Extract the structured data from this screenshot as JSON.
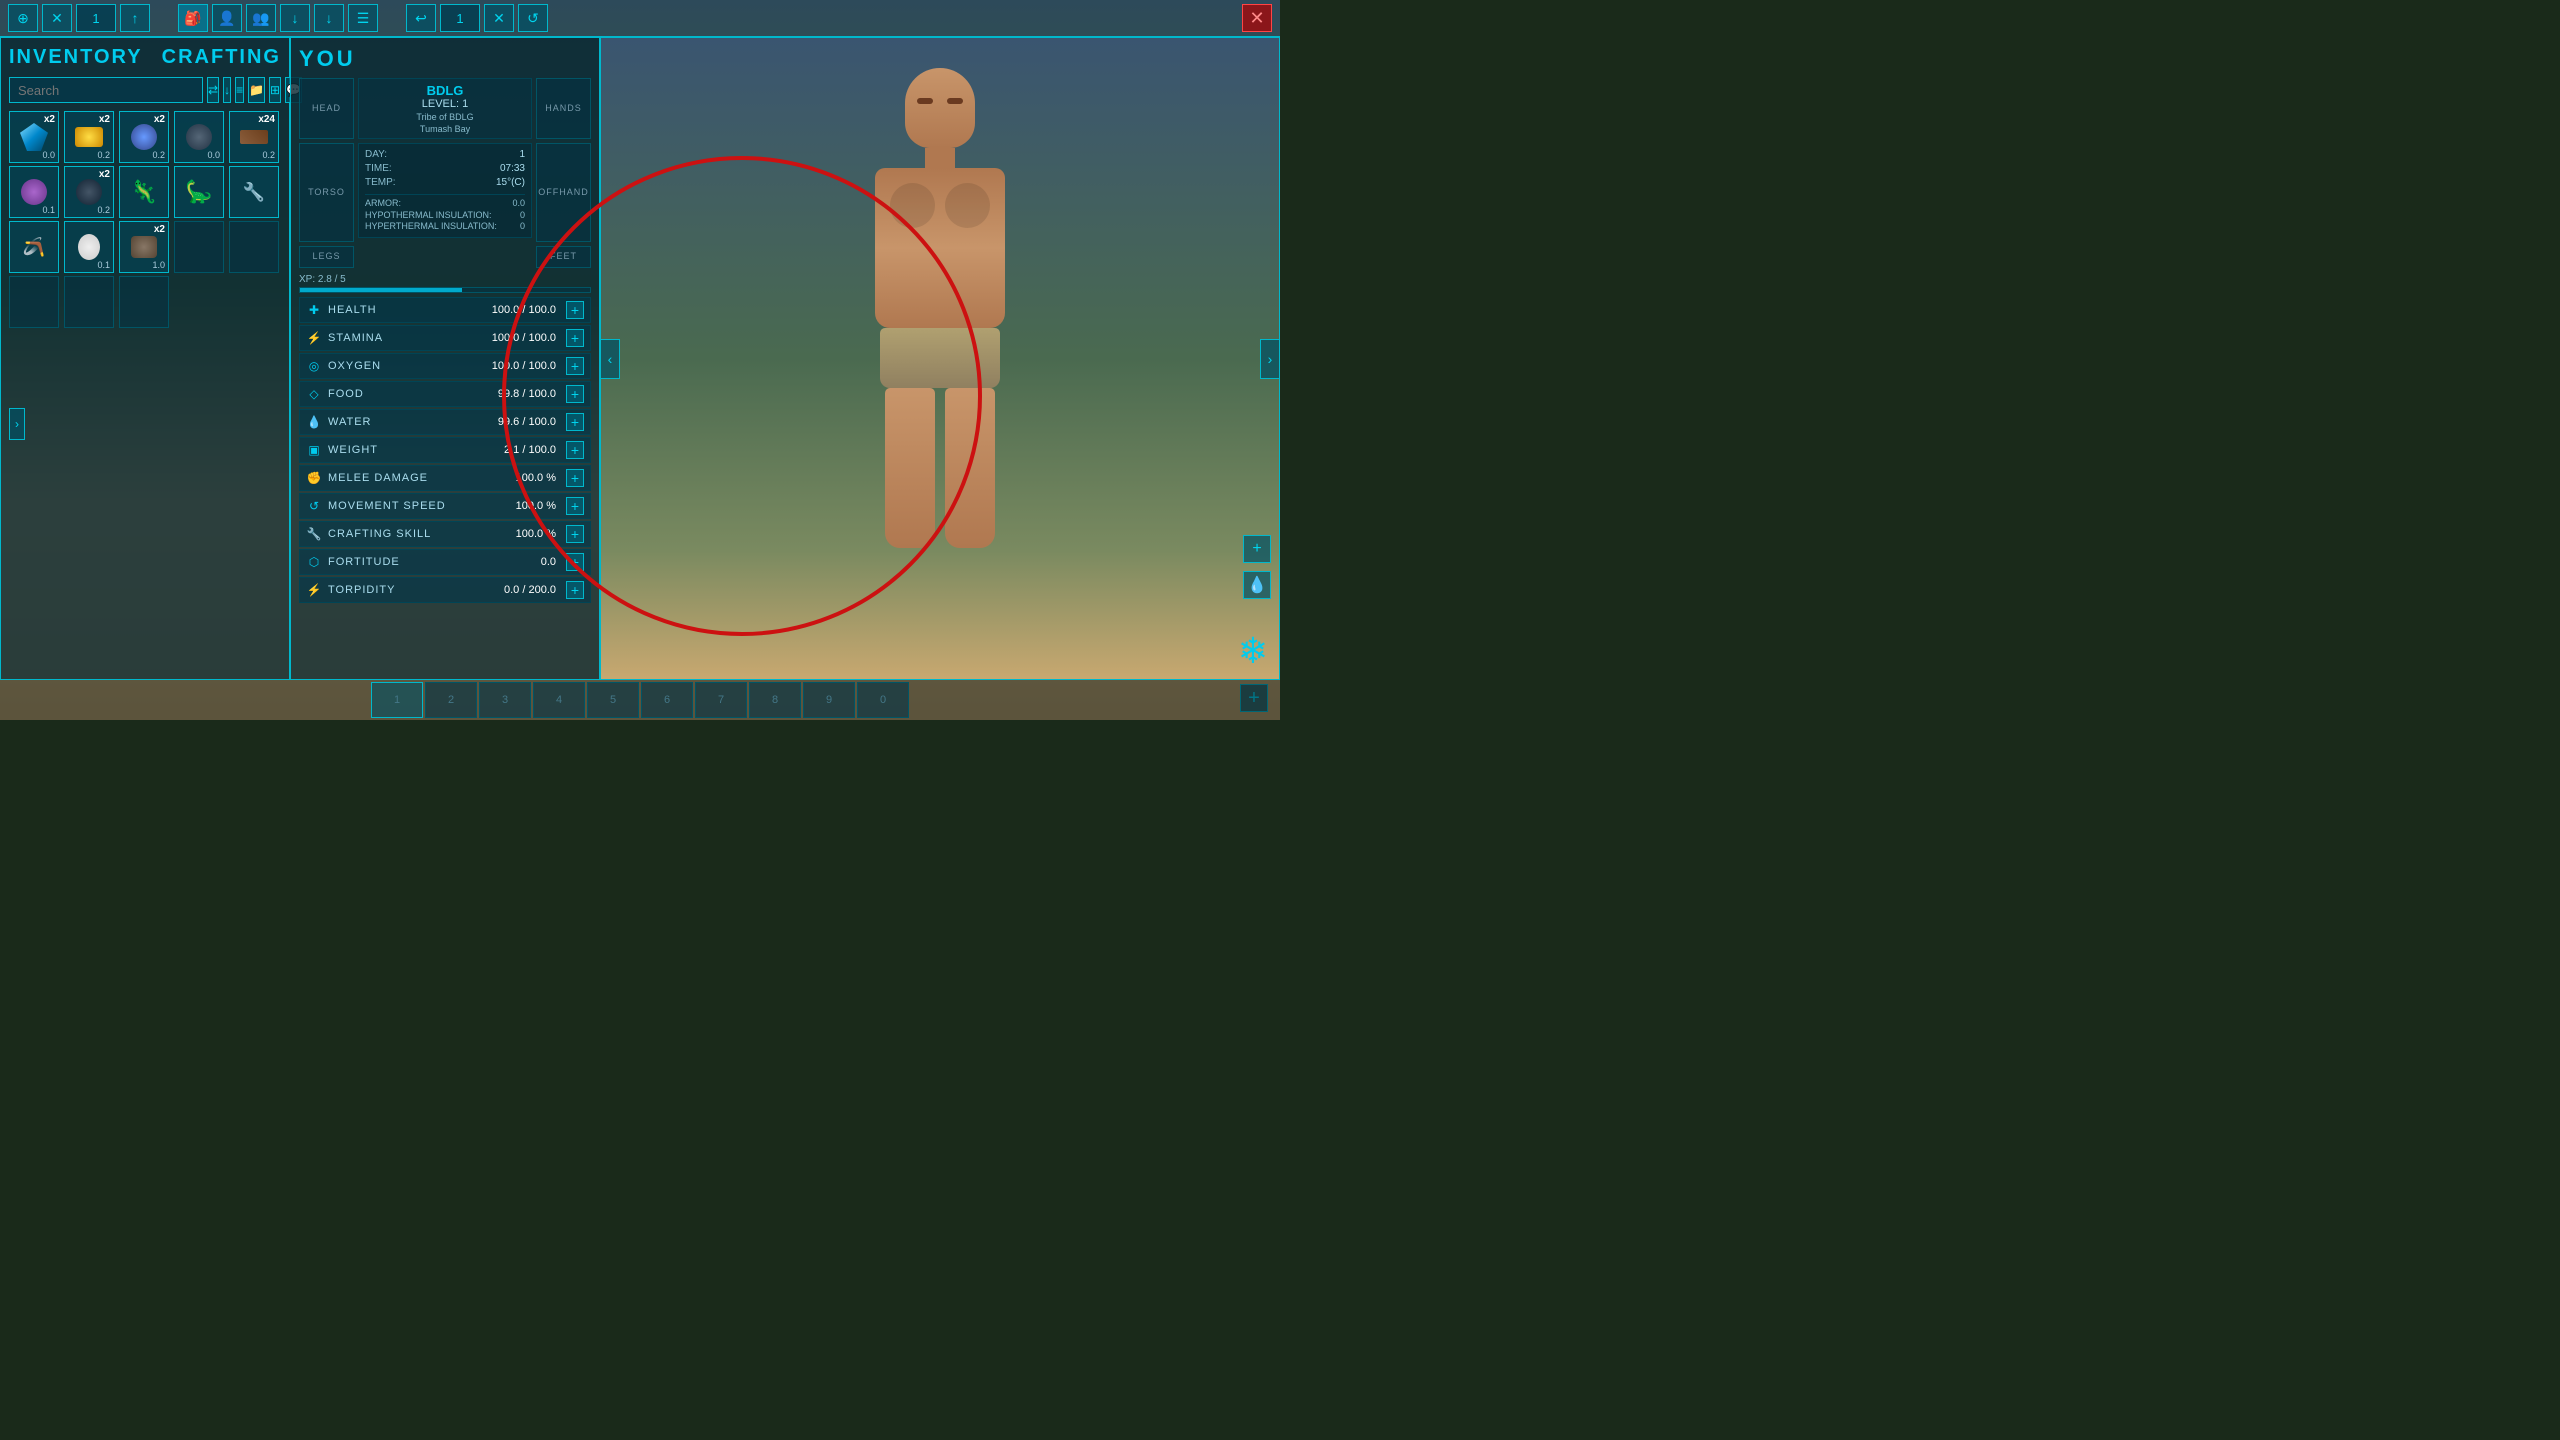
{
  "toolbar": {
    "left": {
      "btn1_icon": "⊕",
      "btn2_icon": "✕",
      "counter": "1",
      "btn3_icon": "↑"
    },
    "middle": {
      "btn1_icon": "🎒",
      "btn2_icon": "👤",
      "btn3_icon": "👥",
      "btn4_icon": "↓",
      "btn5_icon": "↓",
      "btn6_icon": "☰"
    },
    "right": {
      "btn1_icon": "↩",
      "counter": "1",
      "btn2_icon": "✕",
      "btn3_icon": "↺"
    },
    "close_icon": "✕"
  },
  "inventory": {
    "title": "INVENTORY",
    "crafting_title": "CRAFTING",
    "search_placeholder": "Search",
    "items": [
      {
        "count": "x2",
        "value": "0.0",
        "has_item": true,
        "type": "gem"
      },
      {
        "count": "x2",
        "value": "0.2",
        "has_item": true,
        "type": "yellow"
      },
      {
        "count": "x2",
        "value": "0.2",
        "has_item": true,
        "type": "blue"
      },
      {
        "count": "",
        "value": "0.0",
        "has_item": true,
        "type": "dark"
      },
      {
        "count": "x24",
        "value": "0.2",
        "has_item": true,
        "type": "brown"
      },
      {
        "count": "",
        "value": "0.1",
        "has_item": true,
        "type": "purple"
      },
      {
        "count": "x2",
        "value": "0.2",
        "has_item": true,
        "type": "black"
      },
      {
        "count": "",
        "value": "",
        "has_item": true,
        "type": "dino-red"
      },
      {
        "count": "",
        "value": "",
        "has_item": true,
        "type": "dino-green"
      },
      {
        "count": "",
        "value": "",
        "has_item": true,
        "type": "tool"
      },
      {
        "count": "",
        "value": "",
        "has_item": true,
        "type": "tool2"
      },
      {
        "count": "",
        "value": "0.1",
        "has_item": true,
        "type": "egg"
      },
      {
        "count": "x2",
        "value": "1.0",
        "has_item": true,
        "type": "rock"
      },
      {
        "count": "",
        "value": "",
        "has_item": false,
        "type": ""
      },
      {
        "count": "",
        "value": "",
        "has_item": false,
        "type": ""
      },
      {
        "count": "",
        "value": "",
        "has_item": false,
        "type": ""
      },
      {
        "count": "",
        "value": "",
        "has_item": false,
        "type": ""
      },
      {
        "count": "",
        "value": "",
        "has_item": false,
        "type": ""
      }
    ]
  },
  "you": {
    "title": "YOU",
    "player_name": "BDLG",
    "level_label": "LEVEL: 1",
    "tribe_label": "Tribe of BDLG",
    "location_label": "Tumash Bay",
    "head_slot": "HEAD",
    "hands_slot": "HANDS",
    "torso_slot": "ToRSO",
    "offhand_slot": "OFFHAND",
    "legs_slot": "LEGS",
    "feet_slot": "FEET",
    "day_label": "DAY:",
    "day_val": "1",
    "time_label": "TIME:",
    "time_val": "07:33",
    "temp_label": "TEMP:",
    "temp_val": "15°(C)",
    "armor_label": "ARMOR:",
    "armor_val": "0.0",
    "hypo_label": "HYPOTHERMAL INSULATION:",
    "hypo_val": "0",
    "hyper_label": "HYPERTHERMAL INSULATION:",
    "hyper_val": "0",
    "xp_label": "XP: 2.8 / 5",
    "stats": [
      {
        "icon": "+",
        "name": "HEALTH",
        "value": "100.0 / 100.0"
      },
      {
        "icon": "⚡",
        "name": "STAMINA",
        "value": "100.0 / 100.0"
      },
      {
        "icon": "◎",
        "name": "OXYGEN",
        "value": "100.0 / 100.0"
      },
      {
        "icon": "◇",
        "name": "FOOD",
        "value": "99.8 / 100.0"
      },
      {
        "icon": "💧",
        "name": "WATER",
        "value": "99.6 / 100.0"
      },
      {
        "icon": "▣",
        "name": "WEIGHT",
        "value": "2.1 / 100.0"
      },
      {
        "icon": "✊",
        "name": "MELEE DAMAGE",
        "value": "100.0 %"
      },
      {
        "icon": "↺",
        "name": "MOVEMENT SPEED",
        "value": "100.0 %"
      },
      {
        "icon": "🔧",
        "name": "CRAFTING SKILL",
        "value": "100.0 %"
      },
      {
        "icon": "⬡",
        "name": "FORTITUDE",
        "value": "0.0"
      },
      {
        "icon": "⚡",
        "name": "TORPIDITY",
        "value": "0.0 / 200.0"
      }
    ]
  },
  "hotbar": {
    "slots": [
      "1",
      "2",
      "3",
      "4",
      "5",
      "6",
      "7",
      "8",
      "9",
      "0"
    ],
    "active_slot": 0
  },
  "red_circle": {
    "visible": true,
    "note": "annotation circle highlighting stats area"
  }
}
